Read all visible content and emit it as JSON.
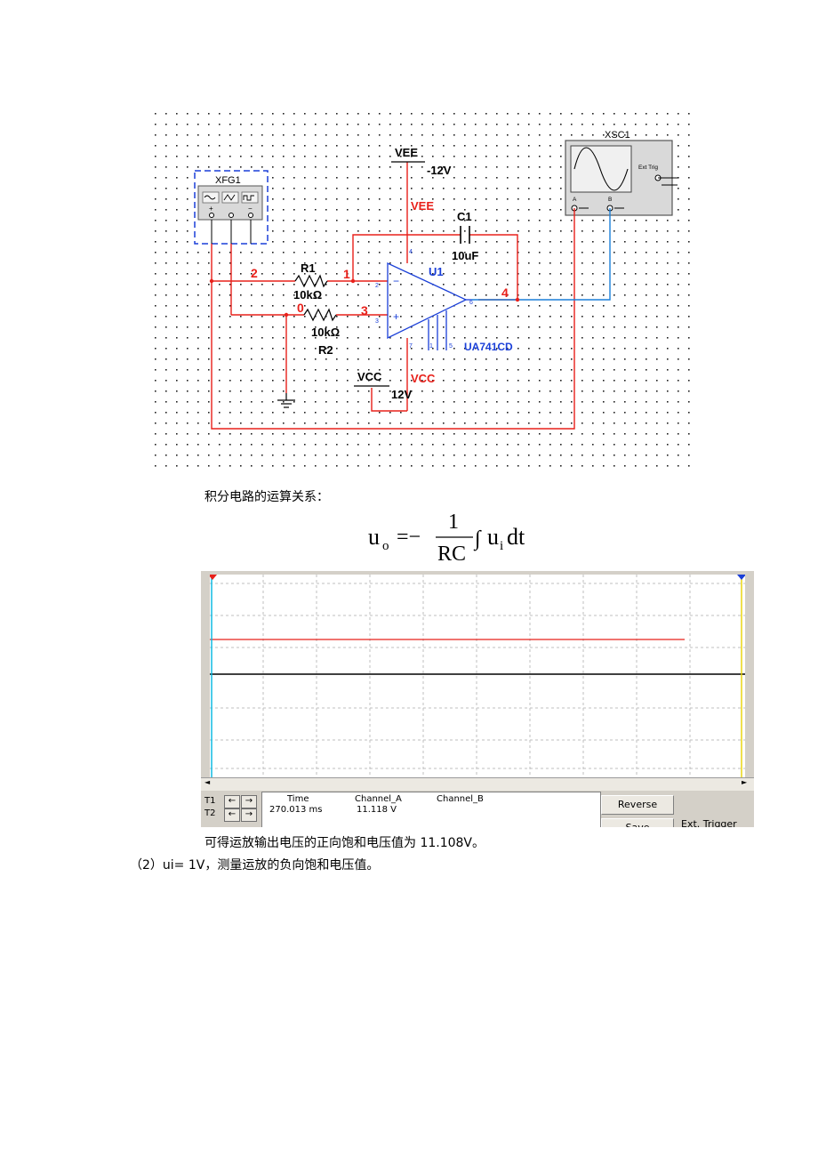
{
  "schematic": {
    "function_generator": {
      "label": "XFG1"
    },
    "oscilloscope": {
      "label": "XSC1",
      "ext_trig": "Ext Trig",
      "ch_a": "A",
      "ch_b": "B"
    },
    "vee": {
      "label": "VEE",
      "value": "-12V",
      "rail_label": "VEE"
    },
    "vcc": {
      "label": "VCC",
      "value": "12V",
      "rail_label": "VCC"
    },
    "r1": {
      "label": "R1",
      "value": "10kΩ"
    },
    "r2": {
      "label": "R2",
      "value": "10kΩ"
    },
    "c1": {
      "label": "C1",
      "value": "10uF"
    },
    "opamp": {
      "label": "U1",
      "model": "UA741CD"
    },
    "nodes": {
      "n1": "1",
      "n2": "2",
      "n3": "3",
      "n4": "4",
      "n0": "0"
    },
    "pins": {
      "p2": "2",
      "p3": "3",
      "p4": "4",
      "p6": "6",
      "p7": "7",
      "p1": "1",
      "p5": "5"
    }
  },
  "text": {
    "relation_heading": "积分电路的运算关系：",
    "result_line": "可得运放输出电压的正向饱和电压值为 11.108V。",
    "item2_line": "（2）ui= 1V，测量运放的负向饱和电压值。"
  },
  "formula": {
    "lhs": "u",
    "lhs_sub": "o",
    "eq": "=−",
    "num": "1",
    "den": "RC",
    "integral": "∫",
    "u": "u",
    "u_sub": "i",
    "dt": "dt"
  },
  "scope_panel": {
    "t1": "T1",
    "t2": "T2",
    "col_time": "Time",
    "col_a": "Channel_A",
    "col_b": "Channel_B",
    "time_value": "270.013 ms",
    "a_value": "11.118 V",
    "reverse_button": "Reverse",
    "save_button": "Save",
    "ext_trigger": "Ext. Trigger",
    "scroll_left": "◄",
    "scroll_right": "►",
    "arrow_left": "←",
    "arrow_right": "→",
    "colors": {
      "trace_a": "#e8201a",
      "trace_b": "#000000",
      "cursor1": "#00b7e0",
      "cursor2": "#e8d200",
      "grid": "#bfbfbf"
    }
  }
}
